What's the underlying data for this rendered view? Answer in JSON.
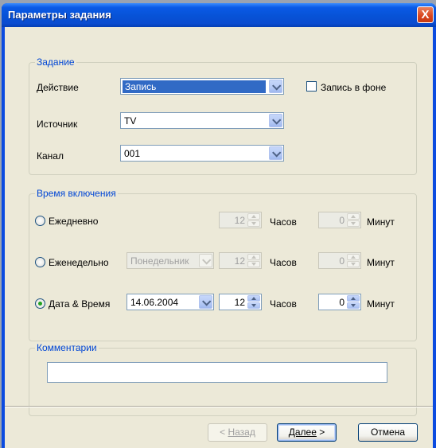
{
  "window": {
    "title": "Параметры задания",
    "close_label": "X"
  },
  "task_group": {
    "legend": "Задание",
    "action_label": "Действие",
    "action_value": "Запись",
    "background_checkbox_label": "Запись в фоне",
    "source_label": "Источник",
    "source_value": "TV",
    "channel_label": "Канал",
    "channel_value": "001"
  },
  "time_group": {
    "legend": "Время включения",
    "daily": {
      "label": "Ежедневно",
      "hours": "12",
      "hours_unit": "Часов",
      "minutes": "0",
      "minutes_unit": "Минут"
    },
    "weekly": {
      "label": "Еженедельно",
      "day_value": "Понедельник",
      "hours": "12",
      "hours_unit": "Часов",
      "minutes": "0",
      "minutes_unit": "Минут"
    },
    "datetime": {
      "label": "Дата & Время",
      "date_value": "14.06.2004",
      "hours": "12",
      "hours_unit": "Часов",
      "minutes": "0",
      "minutes_unit": "Минут"
    },
    "selected": "datetime"
  },
  "comment_group": {
    "legend": "Комментарии",
    "value": ""
  },
  "buttons": {
    "back_arrow": "< ",
    "back_label": "Назад",
    "next_label": "Далее",
    "next_arrow": " >",
    "cancel_label": "Отмена"
  },
  "colors": {
    "title_bar": "#0752d6",
    "legend_text": "#0046d5",
    "selection": "#316ac5",
    "dialog_bg": "#ece9d8"
  }
}
